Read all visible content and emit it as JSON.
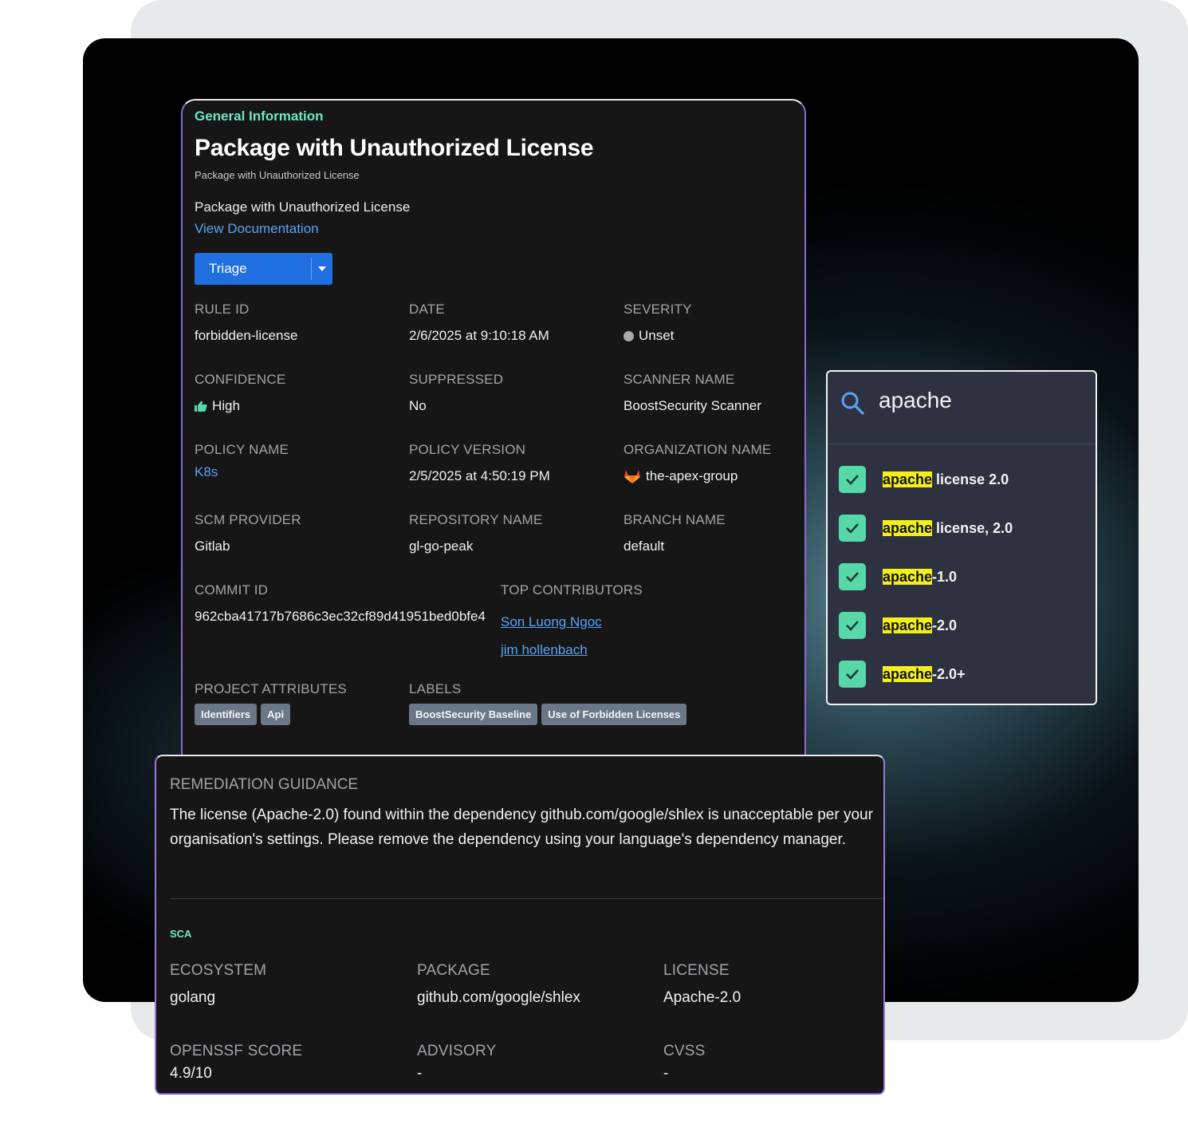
{
  "general": {
    "section_tag": "General Information",
    "title": "Package with Unauthorized License",
    "subtitle": "Package with Unauthorized License",
    "description": "Package with Unauthorized License",
    "doc_link": "View Documentation",
    "triage_label": "Triage"
  },
  "fields": {
    "rule_id": {
      "label": "RULE ID",
      "value": "forbidden-license"
    },
    "date": {
      "label": "DATE",
      "value": "2/6/2025 at 9:10:18 AM"
    },
    "severity": {
      "label": "SEVERITY",
      "value": "Unset"
    },
    "confidence": {
      "label": "CONFIDENCE",
      "value": "High"
    },
    "suppressed": {
      "label": "SUPPRESSED",
      "value": "No"
    },
    "scanner_name": {
      "label": "SCANNER NAME",
      "value": "BoostSecurity Scanner"
    },
    "policy_name": {
      "label": "POLICY NAME",
      "value": "K8s"
    },
    "policy_version": {
      "label": "POLICY VERSION",
      "value": "2/5/2025 at 4:50:19 PM"
    },
    "organization_name": {
      "label": "ORGANIZATION NAME",
      "value": "the-apex-group"
    },
    "scm_provider": {
      "label": "SCM PROVIDER",
      "value": "Gitlab"
    },
    "repository_name": {
      "label": "REPOSITORY NAME",
      "value": "gl-go-peak"
    },
    "branch_name": {
      "label": "BRANCH NAME",
      "value": "default"
    },
    "commit_id": {
      "label": "COMMIT ID",
      "value": "962cba41717b7686c3ec32cf89d41951bed0bfe4"
    },
    "top_contributors": {
      "label": "TOP CONTRIBUTORS",
      "values": [
        "Son Luong Ngoc",
        "jim hollenbach"
      ]
    },
    "project_attributes": {
      "label": "PROJECT ATTRIBUTES",
      "chips": [
        "Identifiers",
        "Api"
      ]
    },
    "labels": {
      "label": "LABELS",
      "chips": [
        "BoostSecurity Baseline",
        "Use of Forbidden Licenses"
      ]
    }
  },
  "remediation": {
    "label": "REMEDIATION GUIDANCE",
    "text": "The license (Apache-2.0) found within the dependency github.com/google/shlex is unacceptable per your organisation's settings. Please remove the dependency using your language's dependency manager.",
    "section_tag": "SCA",
    "ecosystem": {
      "label": "ECOSYSTEM",
      "value": "golang"
    },
    "package": {
      "label": "PACKAGE",
      "value": "github.com/google/shlex"
    },
    "license": {
      "label": "LICENSE",
      "value": "Apache-2.0"
    },
    "openssf_score": {
      "label": "OPENSSF SCORE",
      "value": "4.9/10"
    },
    "advisory": {
      "label": "ADVISORY",
      "value": "-"
    },
    "cvss": {
      "label": "CVSS",
      "value": "-"
    }
  },
  "search": {
    "query": "apache",
    "results": [
      {
        "match": "apache",
        "rest": " license 2.0",
        "checked": true
      },
      {
        "match": "apache",
        "rest": " license, 2.0",
        "checked": true
      },
      {
        "match": "apache",
        "rest": "-1.0",
        "checked": true
      },
      {
        "match": "apache",
        "rest": "-2.0",
        "checked": true
      },
      {
        "match": "apache",
        "rest": "-2.0+",
        "checked": true
      }
    ]
  },
  "icons": {
    "severity": "dot-icon",
    "confidence": "thumbs-up-icon",
    "organization": "gitlab-fox-icon",
    "search": "search-icon",
    "checkbox": "check-icon"
  },
  "colors": {
    "accent_teal": "#6fe8c4",
    "link_blue": "#5aa3f2",
    "triage_blue": "#1f6fe0",
    "checkbox_green": "#56d8a8",
    "highlight_yellow": "#f4f01a"
  }
}
